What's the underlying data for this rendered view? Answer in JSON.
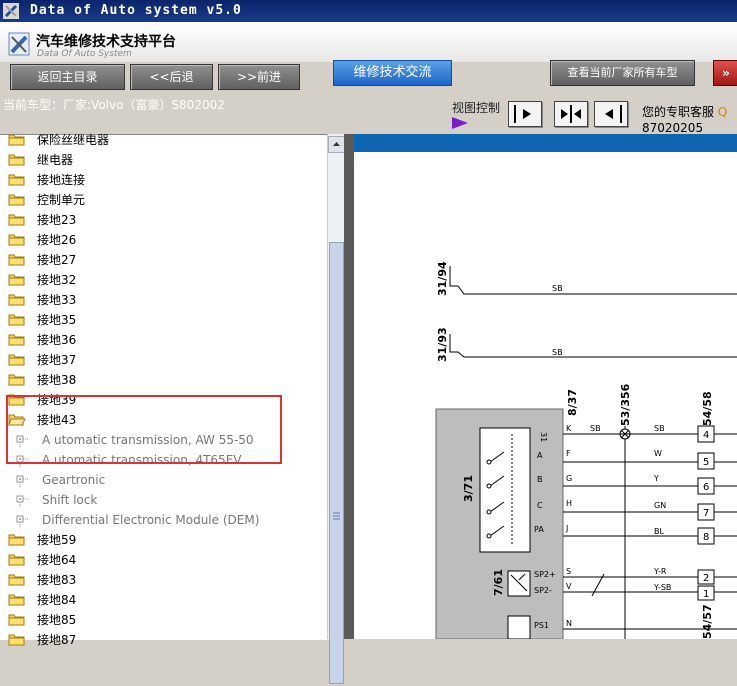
{
  "window": {
    "title": "Data of Auto system v5.0"
  },
  "app": {
    "title_cn": "汽车维修技术支持平台",
    "title_en": "Data Of Auto System"
  },
  "toolbar": {
    "back_main": "返回主目录",
    "back": "<<后退",
    "forward": ">>前进",
    "exchange": "维修技术交流",
    "view_all": "查看当前厂家所有车型",
    "close": "»"
  },
  "status": {
    "current_model": "当前车型：厂家:Volvo（富豪）S802002",
    "view_control": "视图控制",
    "support_label": "您的专职客服",
    "support_link": "Q",
    "hotline": "87020205"
  },
  "tree": {
    "items": [
      {
        "label": "保险丝继电器",
        "type": "folder"
      },
      {
        "label": "继电器",
        "type": "folder"
      },
      {
        "label": "接地连接",
        "type": "folder"
      },
      {
        "label": "控制单元",
        "type": "folder"
      },
      {
        "label": "接地23",
        "type": "folder"
      },
      {
        "label": "接地26",
        "type": "folder"
      },
      {
        "label": "接地27",
        "type": "folder"
      },
      {
        "label": "接地32",
        "type": "folder"
      },
      {
        "label": "接地33",
        "type": "folder"
      },
      {
        "label": "接地35",
        "type": "folder"
      },
      {
        "label": "接地36",
        "type": "folder"
      },
      {
        "label": "接地37",
        "type": "folder"
      },
      {
        "label": "接地38",
        "type": "folder"
      },
      {
        "label": "接地39",
        "type": "folder"
      },
      {
        "label": "接地43",
        "type": "folder-open"
      },
      {
        "label": "A utomatic transmission, AW 55-50",
        "type": "leaf"
      },
      {
        "label": "A utomatic transmission, 4T65EV",
        "type": "leaf"
      },
      {
        "label": "Geartronic",
        "type": "leaf"
      },
      {
        "label": "Shift lock",
        "type": "leaf"
      },
      {
        "label": "Differential Electronic Module (DEM)",
        "type": "leaf"
      },
      {
        "label": "接地59",
        "type": "folder"
      },
      {
        "label": "接地64",
        "type": "folder"
      },
      {
        "label": "接地83",
        "type": "folder"
      },
      {
        "label": "接地84",
        "type": "folder"
      },
      {
        "label": "接地85",
        "type": "folder"
      },
      {
        "label": "接地87",
        "type": "folder"
      }
    ]
  },
  "diagram": {
    "refs_top": [
      "31/94",
      "31/93"
    ],
    "wire_sb": "SB",
    "col_labels": [
      "8/37",
      "53/356",
      "54/58"
    ],
    "bottom_ref": "54/57",
    "module_3_71": "3/71",
    "module_7_61": "7/61",
    "pin_31": "31",
    "pins": [
      "A",
      "B",
      "C",
      "PA"
    ],
    "wire_letters": [
      "K",
      "F",
      "G",
      "H",
      "J",
      "S",
      "V",
      "N"
    ],
    "wire_colors": [
      "SB",
      "W",
      "Y",
      "GN",
      "BL",
      "Y-R",
      "Y-SB"
    ],
    "connector_pins": [
      "4",
      "5",
      "6",
      "7",
      "8",
      "2",
      "1"
    ],
    "sp_labels": [
      "SP2+",
      "SP2-",
      "PS1"
    ],
    "colors": {
      "accent": "#0e66b0",
      "title_bar": "#0a246a",
      "highlight": "#dd3333"
    }
  }
}
